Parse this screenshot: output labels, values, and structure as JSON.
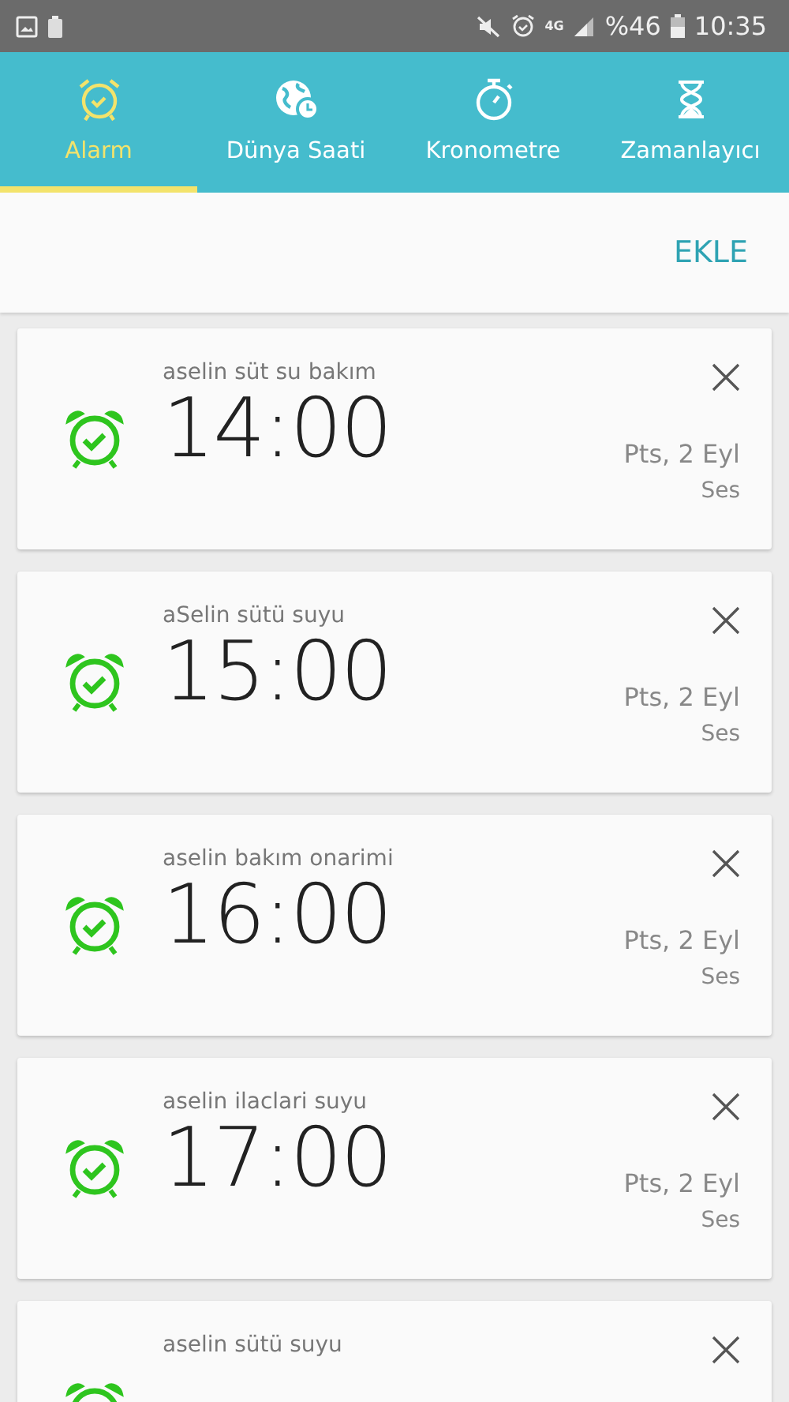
{
  "status_bar": {
    "network": "4G",
    "battery": "%46",
    "time": "10:35"
  },
  "tabs": [
    {
      "label": "Alarm",
      "kind": "alarm",
      "selected": true
    },
    {
      "label": "Dünya Saati",
      "kind": "world",
      "selected": false
    },
    {
      "label": "Kronometre",
      "kind": "stopwatch",
      "selected": false
    },
    {
      "label": "Zamanlayıcı",
      "kind": "timer",
      "selected": false
    }
  ],
  "add_button": "EKLE",
  "alarms": [
    {
      "name": "aselin süt su bakım",
      "time": "14:00",
      "days": "Pts, 2 Eyl",
      "sound": "Ses",
      "on": true
    },
    {
      "name": "aSelin sütü suyu",
      "time": "15:00",
      "days": "Pts, 2 Eyl",
      "sound": "Ses",
      "on": true
    },
    {
      "name": "aselin bakım onarimi",
      "time": "16:00",
      "days": "Pts, 2 Eyl",
      "sound": "Ses",
      "on": true
    },
    {
      "name": "aselin ilaclari suyu",
      "time": "17:00",
      "days": "Pts, 2 Eyl",
      "sound": "Ses",
      "on": true
    },
    {
      "name": "aselin sütü suyu",
      "on": true
    }
  ]
}
